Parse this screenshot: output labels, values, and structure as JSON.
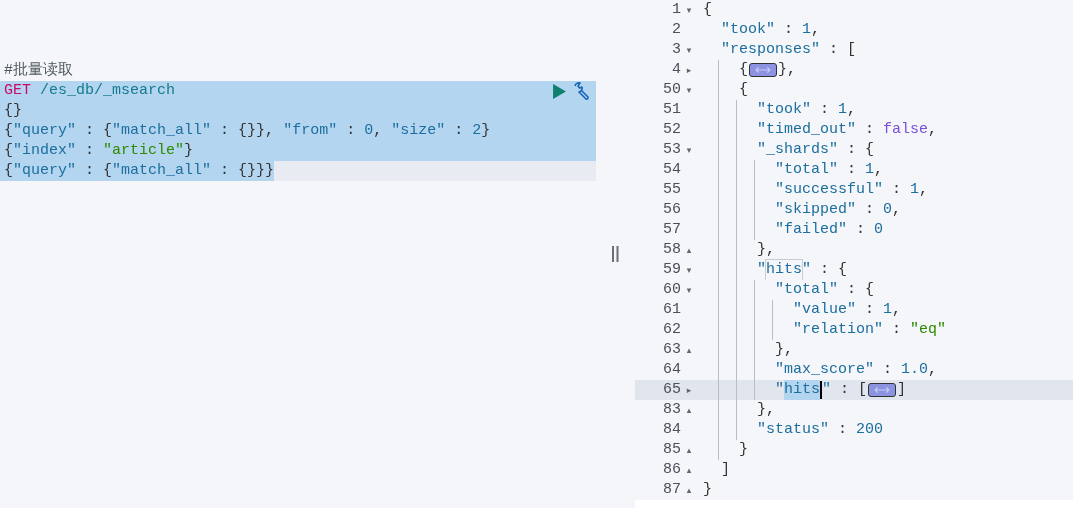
{
  "request_editor": {
    "lines": [
      {
        "selected": false,
        "active": false,
        "actions": false,
        "tokens": [
          {
            "text": "#批量读取",
            "kind": "comment"
          }
        ]
      },
      {
        "selected": true,
        "active": false,
        "actions": true,
        "tokens": [
          {
            "text": "GET",
            "kind": "method"
          },
          {
            "text": " /es_db/_msearch",
            "kind": "path"
          }
        ]
      },
      {
        "selected": true,
        "active": false,
        "actions": false,
        "tokens": [
          {
            "text": "{}",
            "kind": "punct"
          }
        ]
      },
      {
        "selected": true,
        "active": false,
        "actions": false,
        "tokens": [
          {
            "text": "{",
            "kind": "punct"
          },
          {
            "text": "\"query\"",
            "kind": "key"
          },
          {
            "text": " : {",
            "kind": "punct"
          },
          {
            "text": "\"match_all\"",
            "kind": "key"
          },
          {
            "text": " : {}}, ",
            "kind": "punct"
          },
          {
            "text": "\"from\"",
            "kind": "key"
          },
          {
            "text": " : ",
            "kind": "punct"
          },
          {
            "text": "0",
            "kind": "number"
          },
          {
            "text": ", ",
            "kind": "punct"
          },
          {
            "text": "\"size\"",
            "kind": "key"
          },
          {
            "text": " : ",
            "kind": "punct"
          },
          {
            "text": "2",
            "kind": "number"
          },
          {
            "text": "}",
            "kind": "punct"
          }
        ]
      },
      {
        "selected": true,
        "active": false,
        "actions": false,
        "tokens": [
          {
            "text": "{",
            "kind": "punct"
          },
          {
            "text": "\"index\"",
            "kind": "key"
          },
          {
            "text": " : ",
            "kind": "punct"
          },
          {
            "text": "\"article\"",
            "kind": "string"
          },
          {
            "text": "}",
            "kind": "punct"
          }
        ]
      },
      {
        "selected": true,
        "active": true,
        "actions": false,
        "tokens": [
          {
            "text": "{",
            "kind": "punct"
          },
          {
            "text": "\"query\"",
            "kind": "key"
          },
          {
            "text": " : {",
            "kind": "punct"
          },
          {
            "text": "\"match_all\"",
            "kind": "key"
          },
          {
            "text": " : {}}}",
            "kind": "punct"
          }
        ]
      }
    ]
  },
  "response_editor": {
    "lines": [
      {
        "num": "1",
        "fold": "▾",
        "tokens": [
          {
            "text": "{",
            "kind": "punct"
          }
        ]
      },
      {
        "num": "2",
        "tokens": [
          {
            "text": "  \"took\"",
            "kind": "key"
          },
          {
            "text": " : ",
            "kind": "punct"
          },
          {
            "text": "1",
            "kind": "number"
          },
          {
            "text": ",",
            "kind": "punct"
          }
        ]
      },
      {
        "num": "3",
        "fold": "▾",
        "tokens": [
          {
            "text": "  \"responses\"",
            "kind": "key"
          },
          {
            "text": " : [",
            "kind": "punct"
          }
        ]
      },
      {
        "num": "4",
        "fold": "▸",
        "tokens": [
          {
            "text": "    {",
            "kind": "punct"
          },
          {
            "kind": "fold_marker"
          },
          {
            "text": "},",
            "kind": "punct"
          }
        ]
      },
      {
        "num": "50",
        "fold": "▾",
        "tokens": [
          {
            "text": "    {",
            "kind": "punct"
          }
        ]
      },
      {
        "num": "51",
        "tokens": [
          {
            "text": "      \"took\"",
            "kind": "key"
          },
          {
            "text": " : ",
            "kind": "punct"
          },
          {
            "text": "1",
            "kind": "number"
          },
          {
            "text": ",",
            "kind": "punct"
          }
        ]
      },
      {
        "num": "52",
        "tokens": [
          {
            "text": "      \"timed_out\"",
            "kind": "key"
          },
          {
            "text": " : ",
            "kind": "punct"
          },
          {
            "text": "false",
            "kind": "boolean"
          },
          {
            "text": ",",
            "kind": "punct"
          }
        ]
      },
      {
        "num": "53",
        "fold": "▾",
        "tokens": [
          {
            "text": "      \"_shards\"",
            "kind": "key"
          },
          {
            "text": " : {",
            "kind": "punct"
          }
        ]
      },
      {
        "num": "54",
        "tokens": [
          {
            "text": "        \"total\"",
            "kind": "key"
          },
          {
            "text": " : ",
            "kind": "punct"
          },
          {
            "text": "1",
            "kind": "number"
          },
          {
            "text": ",",
            "kind": "punct"
          }
        ]
      },
      {
        "num": "55",
        "tokens": [
          {
            "text": "        \"successful\"",
            "kind": "key"
          },
          {
            "text": " : ",
            "kind": "punct"
          },
          {
            "text": "1",
            "kind": "number"
          },
          {
            "text": ",",
            "kind": "punct"
          }
        ]
      },
      {
        "num": "56",
        "tokens": [
          {
            "text": "        \"skipped\"",
            "kind": "key"
          },
          {
            "text": " : ",
            "kind": "punct"
          },
          {
            "text": "0",
            "kind": "number"
          },
          {
            "text": ",",
            "kind": "punct"
          }
        ]
      },
      {
        "num": "57",
        "tokens": [
          {
            "text": "        \"failed\"",
            "kind": "key"
          },
          {
            "text": " : ",
            "kind": "punct"
          },
          {
            "text": "0",
            "kind": "number"
          }
        ]
      },
      {
        "num": "58",
        "fold": "▴",
        "tokens": [
          {
            "text": "      },",
            "kind": "punct"
          }
        ]
      },
      {
        "num": "59",
        "fold": "▾",
        "tokens": [
          {
            "text": "      \"",
            "kind": "key"
          },
          {
            "text": "hits",
            "kind": "key",
            "match_box": true
          },
          {
            "text": "\"",
            "kind": "key"
          },
          {
            "text": " : {",
            "kind": "punct"
          }
        ]
      },
      {
        "num": "60",
        "fold": "▾",
        "tokens": [
          {
            "text": "        \"total\"",
            "kind": "key"
          },
          {
            "text": " : {",
            "kind": "punct"
          }
        ]
      },
      {
        "num": "61",
        "tokens": [
          {
            "text": "          \"value\"",
            "kind": "key"
          },
          {
            "text": " : ",
            "kind": "punct"
          },
          {
            "text": "1",
            "kind": "number"
          },
          {
            "text": ",",
            "kind": "punct"
          }
        ]
      },
      {
        "num": "62",
        "tokens": [
          {
            "text": "          \"relation\"",
            "kind": "key"
          },
          {
            "text": " : ",
            "kind": "punct"
          },
          {
            "text": "\"eq\"",
            "kind": "string"
          }
        ]
      },
      {
        "num": "63",
        "fold": "▴",
        "tokens": [
          {
            "text": "        },",
            "kind": "punct"
          }
        ]
      },
      {
        "num": "64",
        "tokens": [
          {
            "text": "        \"max_score\"",
            "kind": "key"
          },
          {
            "text": " : ",
            "kind": "punct"
          },
          {
            "text": "1.0",
            "kind": "number"
          },
          {
            "text": ",",
            "kind": "punct"
          }
        ]
      },
      {
        "num": "65",
        "fold": "▸",
        "active": true,
        "tokens": [
          {
            "text": "        \"",
            "kind": "key"
          },
          {
            "text": "hits",
            "kind": "key",
            "selected": true
          },
          {
            "kind": "cursor"
          },
          {
            "text": "\"",
            "kind": "key"
          },
          {
            "text": " : [",
            "kind": "punct"
          },
          {
            "kind": "fold_marker"
          },
          {
            "text": "]",
            "kind": "punct"
          }
        ]
      },
      {
        "num": "83",
        "fold": "▴",
        "tokens": [
          {
            "text": "      },",
            "kind": "punct"
          }
        ]
      },
      {
        "num": "84",
        "tokens": [
          {
            "text": "      \"status\"",
            "kind": "key"
          },
          {
            "text": " : ",
            "kind": "punct"
          },
          {
            "text": "200",
            "kind": "number"
          }
        ]
      },
      {
        "num": "85",
        "fold": "▴",
        "tokens": [
          {
            "text": "    }",
            "kind": "punct"
          }
        ]
      },
      {
        "num": "86",
        "fold": "▴",
        "tokens": [
          {
            "text": "  ]",
            "kind": "punct"
          }
        ]
      },
      {
        "num": "87",
        "fold": "▴",
        "tokens": [
          {
            "text": "}",
            "kind": "punct"
          }
        ]
      }
    ]
  }
}
